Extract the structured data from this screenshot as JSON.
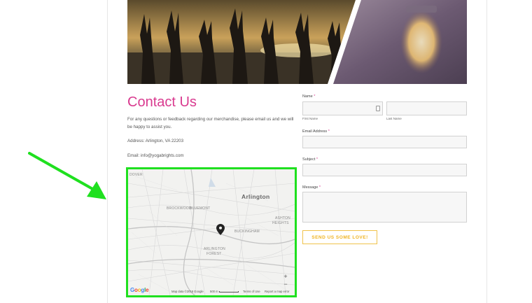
{
  "contact": {
    "title": "Contact Us",
    "intro": "For any questions or feedback regarding our merchandise, please email us and we will be happy to assist you.",
    "address": "Address: Arlington, VA 22203",
    "email": "Email: info@yogabrights.com"
  },
  "map": {
    "city": "Arlington",
    "labels": {
      "dover": "DOVER",
      "brockwood": "BROCKWOOD",
      "bluemont": "BLUEMONT",
      "buckingham": "BUCKINGHAM",
      "ashton": "ASHTON",
      "heights": "HEIGHTS",
      "arlington_forest": "ARLINGTON",
      "forest": "FOREST"
    },
    "logo": "Google",
    "footer": {
      "map_data": "Map data ©2016 Google",
      "scale": "500 m",
      "terms": "Terms of Use",
      "report": "Report a map error"
    },
    "zoom_in": "+",
    "zoom_out": "−",
    "colors": {
      "highlight_border": "#1fe01f",
      "pin": "#222222"
    }
  },
  "form": {
    "name_label": "Name",
    "first_name_hint": "First Name",
    "last_name_hint": "Last Name",
    "email_label": "Email Address",
    "subject_label": "Subject",
    "message_label": "Message",
    "required_mark": "*",
    "submit_label": "SEND US SOME LOVE!",
    "colors": {
      "accent": "#d93a8f",
      "button": "#f0b423"
    }
  },
  "annotation": {
    "arrow_color": "#1fe01f"
  }
}
